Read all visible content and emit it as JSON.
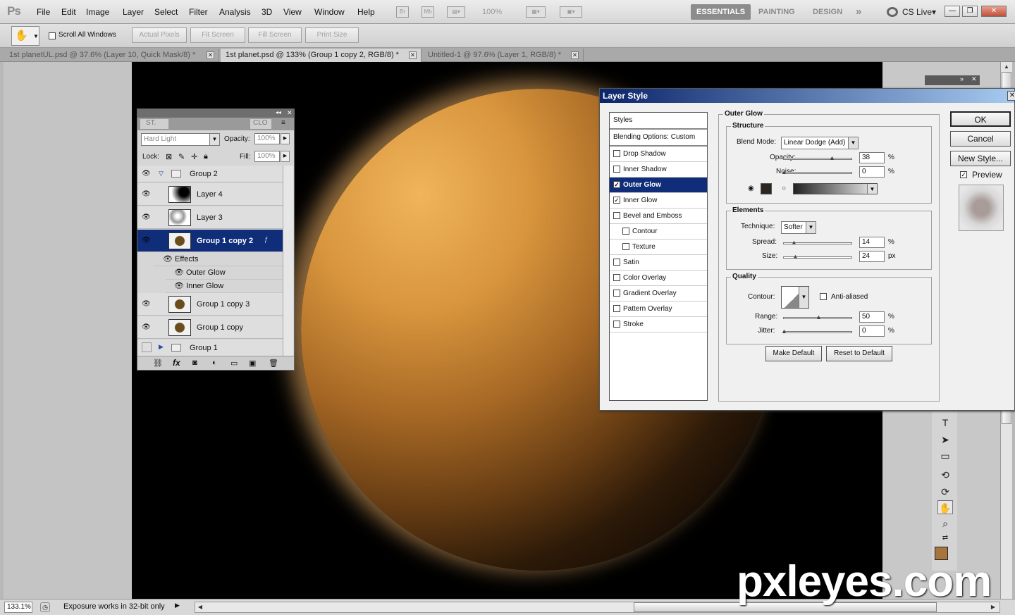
{
  "app": {
    "logo": "Ps"
  },
  "menu": [
    "File",
    "Edit",
    "Image",
    "Layer",
    "Select",
    "Filter",
    "Analysis",
    "3D",
    "View",
    "Window",
    "Help"
  ],
  "menubar": {
    "bridge": "Br",
    "minibridge": "Mb",
    "zoom": "100%",
    "workspaces": [
      "ESSENTIALS",
      "PAINTING",
      "DESIGN"
    ],
    "more": "»",
    "cslive": "CS Live▾",
    "win_min": "—",
    "win_max": "❐",
    "win_close": "✕"
  },
  "options": {
    "scroll_all_windows": "Scroll All Windows",
    "actual_pixels": "Actual Pixels",
    "fit_screen": "Fit Screen",
    "fill_screen": "Fill Screen",
    "print_size": "Print Size"
  },
  "tabs": [
    {
      "label": "1st planetUL.psd @ 37.6% (Layer 10, Quick Mask/8) *"
    },
    {
      "label": "1st planet.psd @ 133% (Group 1 copy 2, RGB/8) *"
    },
    {
      "label": "Untitled-1 @ 97.6% (Layer 1, RGB/8) *"
    }
  ],
  "layers_panel": {
    "tab_styles": "ST.",
    "tab_clone": "CLO",
    "blend_mode": "Hard Light",
    "opacity_label": "Opacity:",
    "opacity": "100%",
    "lock_label": "Lock:",
    "fill_label": "Fill:",
    "fill": "100%",
    "rows": [
      {
        "name": "Group 2"
      },
      {
        "name": "Layer 4"
      },
      {
        "name": "Layer 3"
      },
      {
        "name": "Group 1 copy 2"
      },
      {
        "name": "Effects"
      },
      {
        "name": "Outer Glow"
      },
      {
        "name": "Inner Glow"
      },
      {
        "name": "Group 1 copy 3"
      },
      {
        "name": "Group 1 copy"
      },
      {
        "name": "Group 1"
      }
    ]
  },
  "dialog": {
    "title": "Layer Style",
    "styles_header": "Styles",
    "blending_options": "Blending Options: Custom",
    "styles": [
      {
        "label": "Drop Shadow",
        "checked": false
      },
      {
        "label": "Inner Shadow",
        "checked": false
      },
      {
        "label": "Outer Glow",
        "checked": true
      },
      {
        "label": "Inner Glow",
        "checked": true
      },
      {
        "label": "Bevel and Emboss",
        "checked": false
      },
      {
        "label": "Contour",
        "checked": false
      },
      {
        "label": "Texture",
        "checked": false
      },
      {
        "label": "Satin",
        "checked": false
      },
      {
        "label": "Color Overlay",
        "checked": false
      },
      {
        "label": "Gradient Overlay",
        "checked": false
      },
      {
        "label": "Pattern Overlay",
        "checked": false
      },
      {
        "label": "Stroke",
        "checked": false
      }
    ],
    "section_title": "Outer Glow",
    "structure": {
      "title": "Structure",
      "blend_mode_label": "Blend Mode:",
      "blend_mode": "Linear Dodge (Add)",
      "opacity_label": "Opacity:",
      "opacity": "38",
      "noise_label": "Noise:",
      "noise": "0",
      "percent": "%",
      "glow_color": "#2b2620"
    },
    "elements": {
      "title": "Elements",
      "technique_label": "Technique:",
      "technique": "Softer",
      "spread_label": "Spread:",
      "spread": "14",
      "size_label": "Size:",
      "size": "24",
      "percent": "%",
      "px": "px"
    },
    "quality": {
      "title": "Quality",
      "contour_label": "Contour:",
      "anti_aliased": "Anti-aliased",
      "range_label": "Range:",
      "range": "50",
      "jitter_label": "Jitter:",
      "jitter": "0",
      "percent": "%"
    },
    "make_default": "Make Default",
    "reset_default": "Reset to Default",
    "ok": "OK",
    "cancel": "Cancel",
    "new_style": "New Style...",
    "preview": "Preview"
  },
  "status": {
    "zoom": "133.1%",
    "message": "Exposure works in 32-bit only"
  },
  "watermark": "pxleyes.com"
}
